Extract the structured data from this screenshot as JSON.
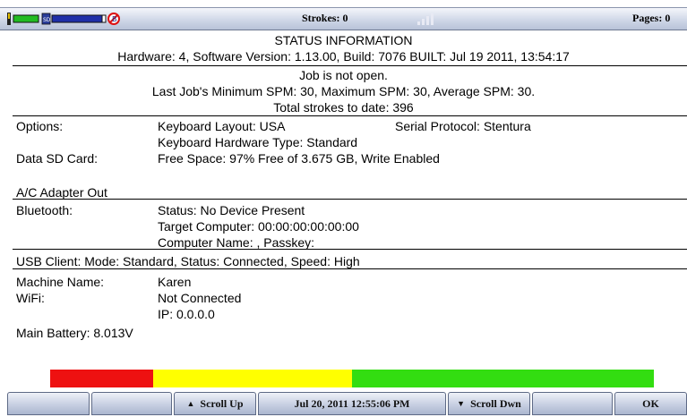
{
  "topbar": {
    "strokes": "Strokes: 0",
    "pages": "Pages: 0"
  },
  "status": {
    "title": "STATUS INFORMATION",
    "hardware_line": "Hardware: 4, Software Version: 1.13.00, Build: 7076  BUILT: Jul 19 2011, 13:54:17",
    "job_line": "Job is not open.",
    "spm_line": "Last Job's Minimum SPM: 30,  Maximum SPM: 30, Average SPM: 30.",
    "strokes_total": "Total strokes to date: 396"
  },
  "options": {
    "label": "Options:",
    "keyboard_layout": "Keyboard Layout: USA",
    "serial_protocol": "Serial Protocol: Stentura",
    "hardware_type": "Keyboard Hardware Type: Standard"
  },
  "sd": {
    "label": "Data SD Card:",
    "value": "Free Space: 97% Free of 3.675 GB, Write Enabled"
  },
  "adapter": "A/C Adapter Out",
  "bluetooth": {
    "label": "Bluetooth:",
    "status": "Status: No Device Present",
    "target": "Target Computer: 00:00:00:00:00:00",
    "name": "Computer Name: ,  Passkey:"
  },
  "usb": "USB Client: Mode: Standard, Status: Connected, Speed: High",
  "machine": {
    "label": "Machine Name:",
    "value": "Karen"
  },
  "wifi": {
    "label": "WiFi:",
    "status": "Not Connected",
    "ip": "IP: 0.0.0.0"
  },
  "battery": {
    "label": "Main Battery: 8.013V",
    "colors": {
      "red": "#ee1111",
      "yellow": "#ffff00",
      "green": "#33dd11"
    }
  },
  "softkeys": {
    "scroll_up": "Scroll Up",
    "datetime": "Jul 20, 2011  12:55:06 PM",
    "scroll_down": "Scroll Dwn",
    "ok": "OK"
  },
  "icons": [
    "battery-icon",
    "sd-card-icon",
    "memory-bar-icon",
    "no-bluetooth-icon",
    "signal-icon"
  ]
}
